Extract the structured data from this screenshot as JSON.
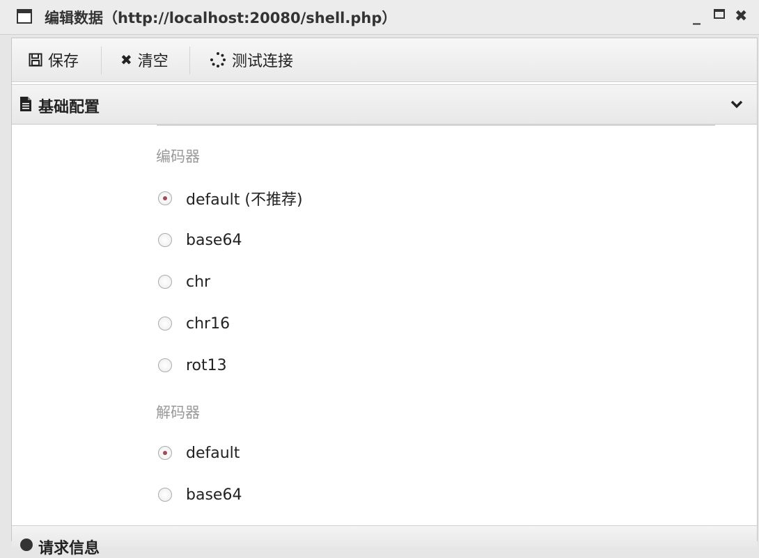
{
  "window": {
    "title": "编辑数据（http://localhost:20080/shell.php）",
    "controls": {
      "minimize": "_",
      "close": "✖"
    }
  },
  "toolbar": {
    "save_label": "保存",
    "clear_label": "清空",
    "clear_icon": "✖",
    "test_label": "测试连接"
  },
  "panel": {
    "title": "基础配置",
    "encoder": {
      "label": "编码器",
      "options": [
        {
          "label": "default (不推荐)",
          "checked": true
        },
        {
          "label": "base64",
          "checked": false
        },
        {
          "label": "chr",
          "checked": false
        },
        {
          "label": "chr16",
          "checked": false
        },
        {
          "label": "rot13",
          "checked": false
        }
      ]
    },
    "decoder": {
      "label": "解码器",
      "options": [
        {
          "label": "default",
          "checked": true
        },
        {
          "label": "base64",
          "checked": false
        }
      ]
    }
  },
  "next_panel": {
    "title": "请求信息"
  },
  "colors": {
    "accent": "#a24a5c",
    "muted_label": "#999999"
  }
}
